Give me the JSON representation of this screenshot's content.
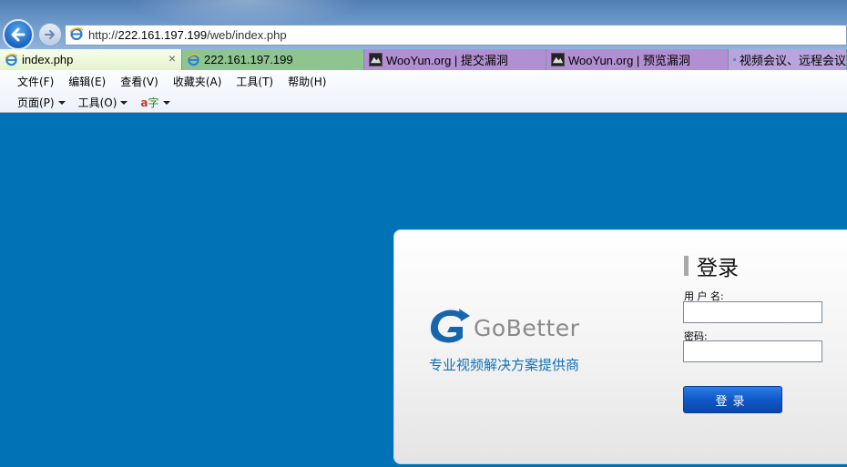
{
  "browser": {
    "address": {
      "protocol": "http://",
      "host": "222.161.197.199",
      "path": "/web/index.php"
    },
    "tabs": [
      {
        "label": "index.php",
        "icon": "ie-icon",
        "active": true
      },
      {
        "label": "222.161.197.199",
        "icon": "ie-icon"
      },
      {
        "label": "WooYun.org | 提交漏洞",
        "icon": "wooyun-icon"
      },
      {
        "label": "WooYun.org | 预览漏洞",
        "icon": "wooyun-icon"
      },
      {
        "label": "视频会议、远程会议",
        "icon": "globe-icon"
      }
    ],
    "close_glyph": "×",
    "menu": [
      "文件(F)",
      "编辑(E)",
      "查看(V)",
      "收藏夹(A)",
      "工具(T)",
      "帮助(H)"
    ],
    "commands": [
      "页面(P)",
      "工具(O)"
    ],
    "translate_glyph_a": "a",
    "translate_glyph_z": "字"
  },
  "colors": {
    "page_bg": "#0172b6",
    "brand_blue": "#1470b8",
    "button_blue": "#0f58c9"
  },
  "login": {
    "brand": "GoBetter",
    "slogan": "专业视频解决方案提供商",
    "title": "登录",
    "username_label": "用 户 名:",
    "password_label": "密码:",
    "username_value": "",
    "password_value": "",
    "submit_label": "登录"
  }
}
